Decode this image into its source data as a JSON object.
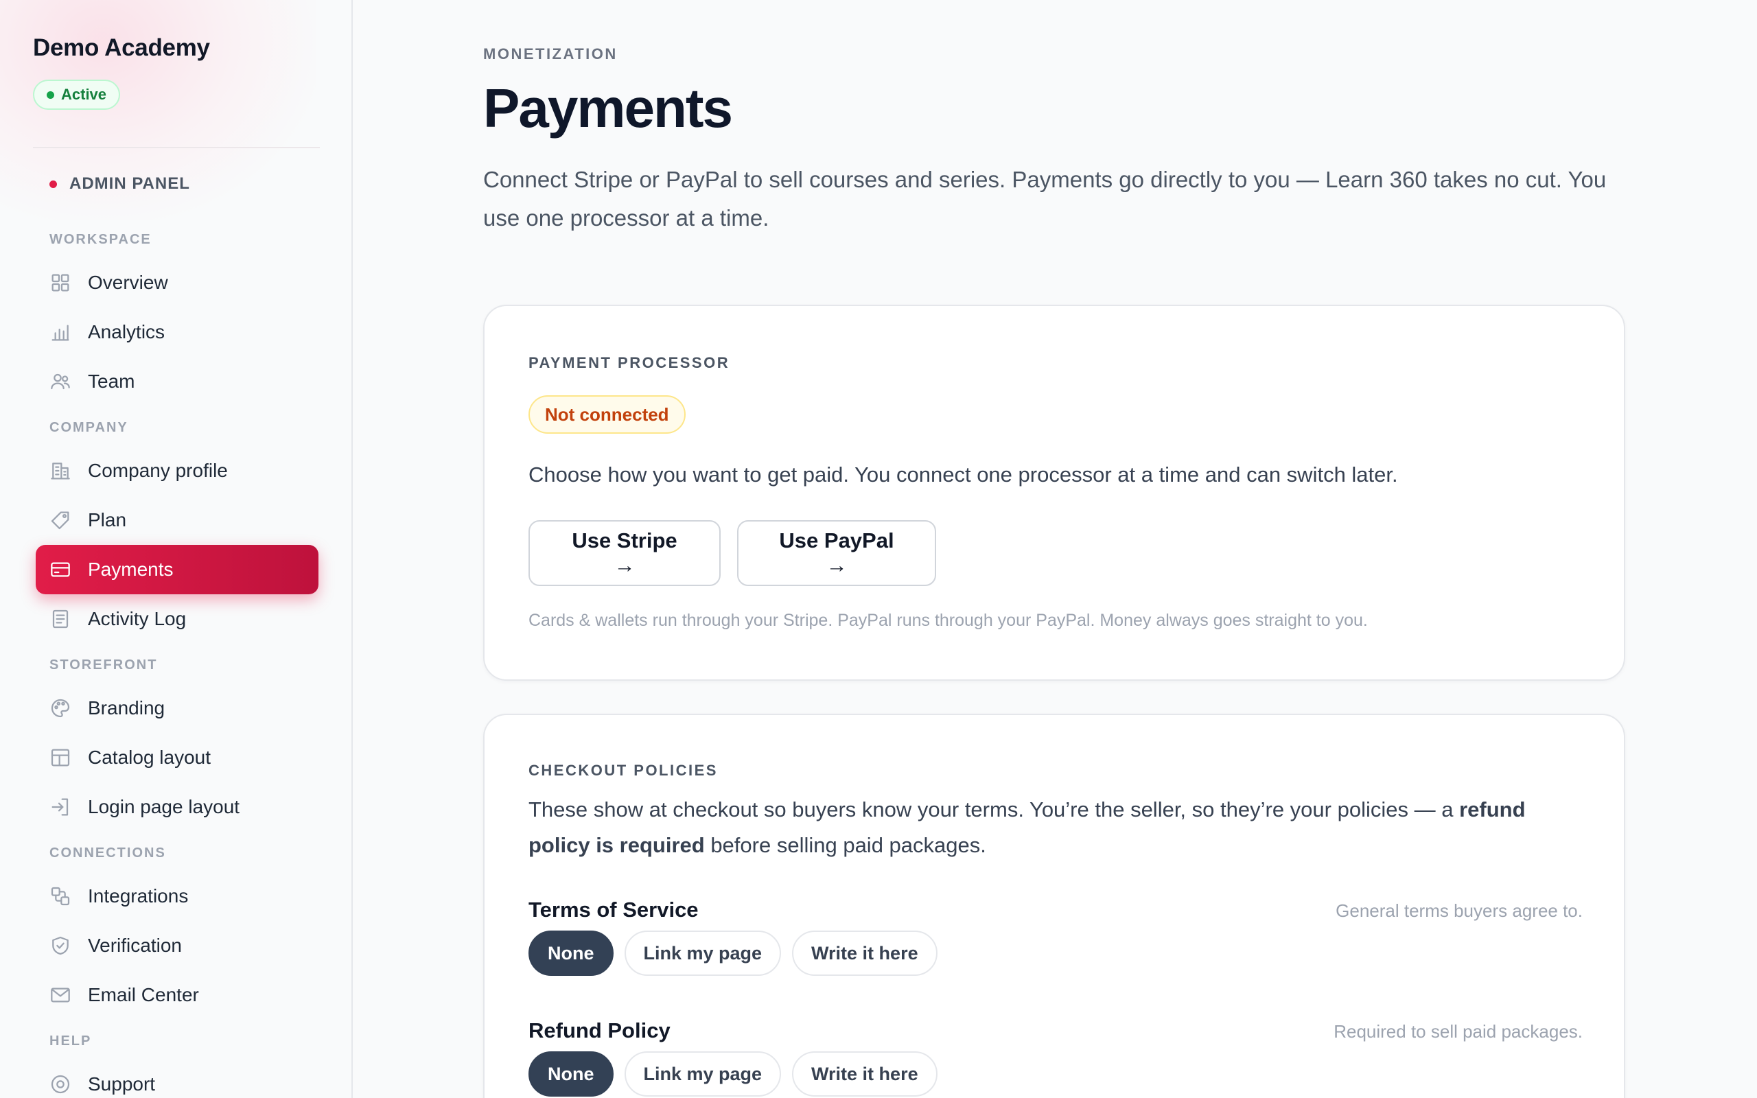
{
  "sidebar": {
    "brand": "Demo Academy",
    "status": "Active",
    "panel_label": "ADMIN PANEL",
    "sections": [
      {
        "label": "WORKSPACE",
        "items": [
          {
            "label": "Overview",
            "icon": "grid-icon"
          },
          {
            "label": "Analytics",
            "icon": "bar-chart-icon"
          },
          {
            "label": "Team",
            "icon": "users-icon"
          }
        ]
      },
      {
        "label": "COMPANY",
        "items": [
          {
            "label": "Company profile",
            "icon": "building-icon"
          },
          {
            "label": "Plan",
            "icon": "tag-icon"
          },
          {
            "label": "Payments",
            "icon": "credit-card-icon",
            "active": true
          },
          {
            "label": "Activity Log",
            "icon": "document-icon"
          }
        ]
      },
      {
        "label": "STOREFRONT",
        "items": [
          {
            "label": "Branding",
            "icon": "palette-icon"
          },
          {
            "label": "Catalog layout",
            "icon": "layout-icon"
          },
          {
            "label": "Login page layout",
            "icon": "login-icon"
          }
        ]
      },
      {
        "label": "CONNECTIONS",
        "items": [
          {
            "label": "Integrations",
            "icon": "integrations-icon"
          },
          {
            "label": "Verification",
            "icon": "shield-check-icon"
          },
          {
            "label": "Email Center",
            "icon": "mail-icon"
          }
        ]
      },
      {
        "label": "HELP",
        "items": [
          {
            "label": "Support",
            "icon": "support-icon"
          }
        ]
      }
    ]
  },
  "page": {
    "eyebrow": "MONETIZATION",
    "title": "Payments",
    "description": "Connect Stripe or PayPal to sell courses and series. Payments go directly to you — Learn 360 takes no cut. You use one processor at a time."
  },
  "processor_card": {
    "label": "PAYMENT PROCESSOR",
    "status": "Not connected",
    "text": "Choose how you want to get paid. You connect one processor at a time and can switch later.",
    "stripe_button": "Use Stripe →",
    "paypal_button": "Use PayPal →",
    "fine_print": "Cards & wallets run through your Stripe. PayPal runs through your PayPal. Money always goes straight to you."
  },
  "policies_card": {
    "label": "CHECKOUT POLICIES",
    "text_before": "These show at checkout so buyers know your terms. You’re the seller, so they’re your policies — a ",
    "text_emphasis": "refund policy is required",
    "text_after": " before selling paid packages.",
    "policies": [
      {
        "title": "Terms of Service",
        "hint": "General terms buyers agree to.",
        "options": [
          "None",
          "Link my page",
          "Write it here"
        ],
        "selected": "None"
      },
      {
        "title": "Refund Policy",
        "hint": "Required to sell paid packages.",
        "options": [
          "None",
          "Link my page",
          "Write it here"
        ],
        "selected": "None"
      }
    ]
  },
  "colors": {
    "accent": "#e11d48",
    "accent_dark": "#be123c",
    "success": "#16a34a",
    "warning": "#c2410c",
    "segment_selected": "#334155"
  }
}
